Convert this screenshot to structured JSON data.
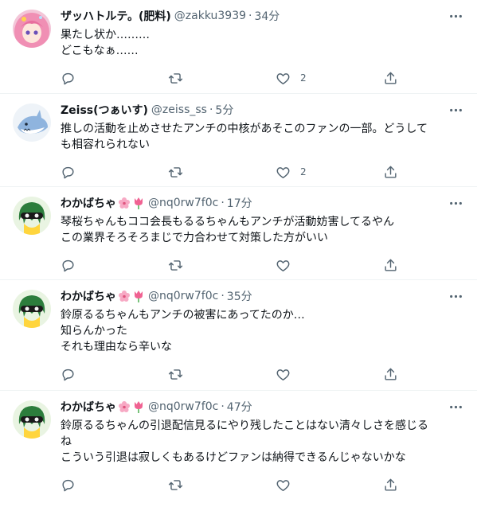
{
  "tweets": [
    {
      "name": "ザッハトルテ。(肥料)",
      "handle": "@zakku3939",
      "time": "34分",
      "lines": [
        "果たし状か………",
        "どこもなぁ……"
      ],
      "reply_count": "",
      "retweet_count": "",
      "like_count": "2",
      "avatar": "anime-girl-pink-hair"
    },
    {
      "name": "Zeiss(つぁいす)",
      "handle": "@zeiss_ss",
      "time": "5分",
      "lines": [
        "推しの活動を止めさせたアンチの中核があそこのファンの一部。どうして",
        "も相容れられない"
      ],
      "reply_count": "",
      "retweet_count": "",
      "like_count": "2",
      "avatar": "blue-shark"
    },
    {
      "name": "わかばちゃ",
      "handle": "@nq0rw7f0c",
      "time": "17分",
      "lines": [
        "琴桜ちゃんもココ会長もるるちゃんもアンチが活動妨害してるやん",
        "この業界そろそろまじで力合わせて対策した方がいい"
      ],
      "reply_count": "",
      "retweet_count": "",
      "like_count": "",
      "avatar": "squid-kid"
    },
    {
      "name": "わかばちゃ",
      "handle": "@nq0rw7f0c",
      "time": "35分",
      "lines": [
        "鈴原るるちゃんもアンチの被害にあってたのか…",
        "知らんかった",
        "それも理由なら辛いな"
      ],
      "reply_count": "",
      "retweet_count": "",
      "like_count": "",
      "avatar": "squid-kid"
    },
    {
      "name": "わかばちゃ",
      "handle": "@nq0rw7f0c",
      "time": "47分",
      "lines": [
        "鈴原るるちゃんの引退配信見るにやり残したことはない清々しさを感じる",
        "ね",
        "こういう引退は寂しくもあるけどファンは納得できるんじゃないかな"
      ],
      "reply_count": "",
      "retweet_count": "",
      "like_count": "",
      "avatar": "squid-kid"
    }
  ],
  "colors": {
    "text": "#0f1419",
    "secondary": "#536471",
    "divider": "#eff3f4"
  }
}
